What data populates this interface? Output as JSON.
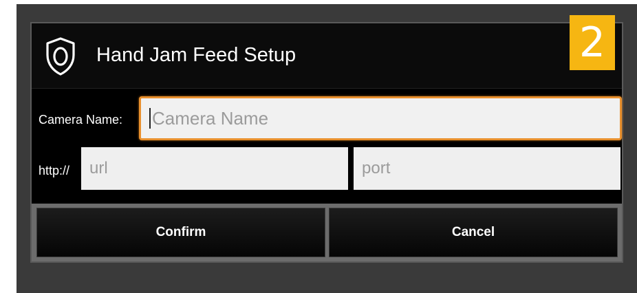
{
  "dialog": {
    "title": "Hand Jam Feed Setup",
    "badge": "2",
    "title_icon": "shield-icon"
  },
  "form": {
    "camera_name_label": "Camera Name:",
    "camera_name_value": "",
    "camera_name_placeholder": "Camera Name",
    "http_label": "http://",
    "url_value": "",
    "url_placeholder": "url",
    "port_value": "",
    "port_placeholder": "port"
  },
  "buttons": {
    "confirm_label": "Confirm",
    "cancel_label": "Cancel"
  },
  "colors": {
    "background": "#3a3a3a",
    "dialog": "#000000",
    "badge": "#f6b612",
    "focus_border": "#e8902e",
    "field_bg": "#efefef"
  }
}
